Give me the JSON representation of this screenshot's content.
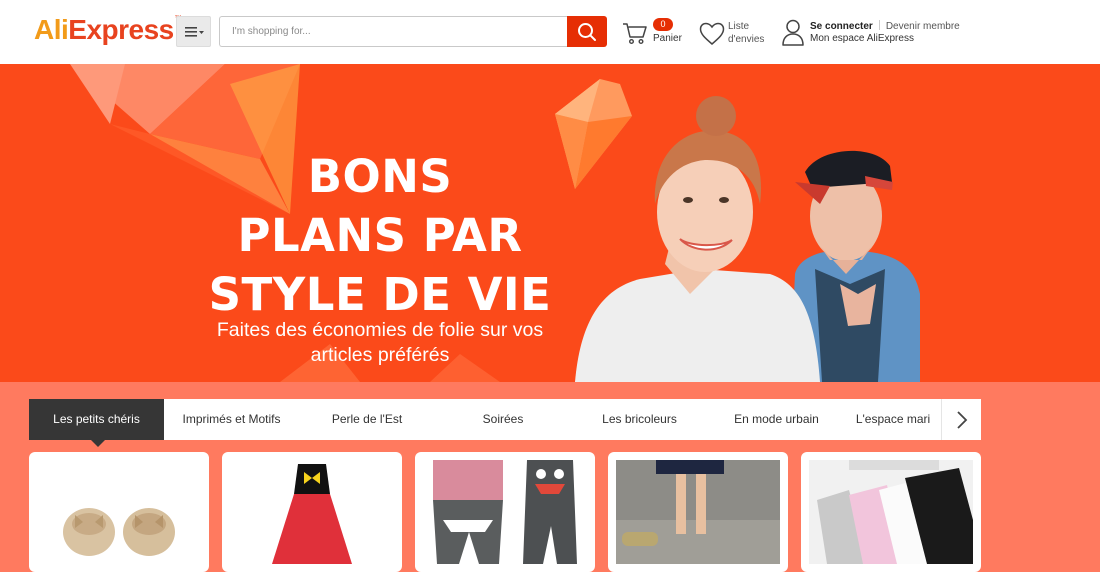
{
  "header": {
    "logo_ali": "Ali",
    "logo_express": "Express",
    "logo_tm": "™",
    "menu_icon": "hamburger-dropdown-icon",
    "search_placeholder": "I'm shopping for...",
    "search_icon": "search-icon",
    "cart": {
      "count": "0",
      "label": "Panier",
      "icon": "cart-icon"
    },
    "wishlist": {
      "line1": "Liste",
      "line2": "d'envies",
      "icon": "heart-icon"
    },
    "account": {
      "signin": "Se connecter",
      "join": "Devenir membre",
      "my_account": "Mon espace AliExpress",
      "icon": "user-icon"
    }
  },
  "banner": {
    "headline_1": "BONS",
    "headline_2": "PLANS PAR",
    "headline_3": "STYLE DE VIE",
    "subline_1": "Faites des économies de folie sur vos",
    "subline_2": "articles préférés",
    "bg_color": "#fb4a1a"
  },
  "tabs": {
    "items": [
      {
        "label": "Les petits chéris",
        "active": true
      },
      {
        "label": "Imprimés et Motifs",
        "active": false
      },
      {
        "label": "Perle de l'Est",
        "active": false
      },
      {
        "label": "Soirées",
        "active": false
      },
      {
        "label": "Les bricoleurs",
        "active": false
      },
      {
        "label": "En mode urbain",
        "active": false
      },
      {
        "label": "L'espace mari",
        "active": false
      }
    ],
    "next_icon": "chevron-right-icon"
  },
  "products": [
    {
      "image": "baby-moccasins-image"
    },
    {
      "image": "girl-dress-image"
    },
    {
      "image": "baby-pants-image"
    },
    {
      "image": "kids-legs-image"
    },
    {
      "image": "tights-image"
    }
  ],
  "colors": {
    "accent": "#e62e04",
    "logo_orange": "#f29b1a",
    "logo_red": "#e8431f",
    "page_bg": "#ff7a5f",
    "active_tab": "#363636"
  }
}
